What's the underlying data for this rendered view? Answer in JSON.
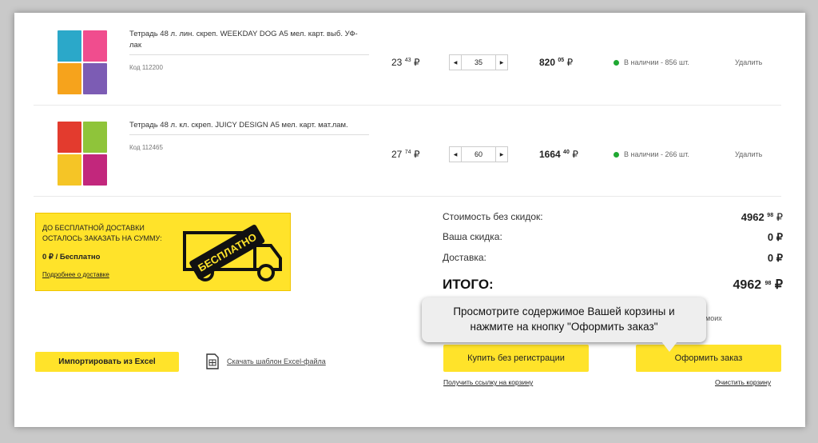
{
  "products": [
    {
      "name": "Тетрадь 48 л. лин. скреп. WEEKDAY DOG А5 мел. карт. выб. УФ-лак",
      "code": "Код 112200",
      "price_int": "23",
      "price_dec": "43",
      "currency": "₽",
      "qty": "35",
      "total_int": "820",
      "total_dec": "05",
      "stock": "В наличии - 856 шт.",
      "delete": "Удалить",
      "thumb_colors": [
        "#2ba8c9",
        "#f04d8e",
        "#f6a31c",
        "#7c5cb4"
      ]
    },
    {
      "name": "Тетрадь 48 л. кл. скреп. JUICY DESIGN А5 мел. карт. мат.лам.",
      "code": "Код 112465",
      "price_int": "27",
      "price_dec": "74",
      "currency": "₽",
      "qty": "60",
      "total_int": "1664",
      "total_dec": "40",
      "stock": "В наличии - 266 шт.",
      "delete": "Удалить",
      "thumb_colors": [
        "#e33b2e",
        "#8fc43a",
        "#f5c526",
        "#c2277c"
      ]
    }
  ],
  "promo": {
    "line1": "ДО БЕСПЛАТНОЙ ДОСТАВКИ",
    "line2": "ОСТАЛОСЬ ЗАКАЗАТЬ НА СУММУ:",
    "amount": "0 ₽ / Бесплатно",
    "link": "Подробнее о доставке",
    "badge": "БЕСПЛАТНО"
  },
  "summary": {
    "cost_label": "Стоимость без скидок:",
    "cost_int": "4962",
    "cost_dec": "98",
    "discount_label": "Ваша скидка:",
    "discount_val": "0 ₽",
    "delivery_label": "Доставка:",
    "delivery_val": "0 ₽",
    "total_label": "ИТОГО:",
    "total_int": "4962",
    "total_dec": "98",
    "currency": "₽",
    "partial_text": "ку моих"
  },
  "tooltip": {
    "line1": "Просмотрите содержимое Вашей корзины и",
    "line2": "нажмите на кнопку \"Оформить заказ\""
  },
  "actions": {
    "import": "Импортировать из Excel",
    "template": "Скачать шаблон Excel-файла",
    "buy": "Купить без регистрации",
    "order": "Оформить заказ",
    "link_cart": "Получить ссылку на корзину",
    "clear_cart": "Очистить корзину"
  },
  "colors": {
    "accent": "#ffe32a",
    "in_stock": "#1fa832"
  }
}
